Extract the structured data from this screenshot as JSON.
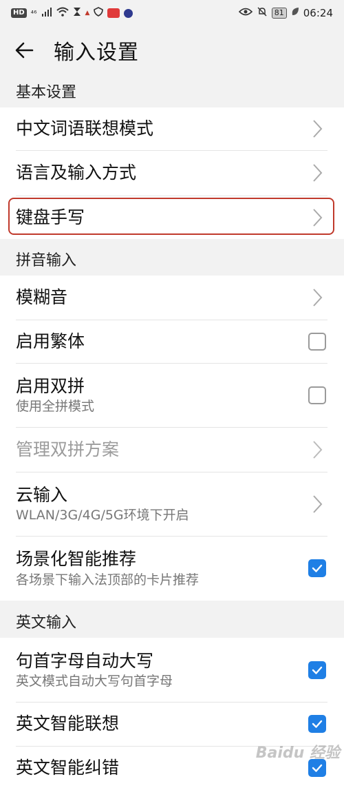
{
  "status_bar": {
    "left_badge": "HD",
    "network": "⁴⁶",
    "battery": "81",
    "time": "06:24"
  },
  "header": {
    "title": "输入设置",
    "back_icon": "back-arrow-icon"
  },
  "sections": {
    "basic": {
      "label": "基本设置",
      "rows": [
        {
          "title": "中文词语联想模式"
        },
        {
          "title": "语言及输入方式"
        },
        {
          "title": "键盘手写"
        }
      ]
    },
    "pinyin": {
      "label": "拼音输入",
      "rows": [
        {
          "title": "模糊音"
        },
        {
          "title": "启用繁体",
          "checked": false
        },
        {
          "title": "启用双拼",
          "subtitle": "使用全拼模式",
          "checked": false
        },
        {
          "title": "管理双拼方案",
          "disabled": true
        },
        {
          "title": "云输入",
          "subtitle": "WLAN/3G/4G/5G环境下开启"
        },
        {
          "title": "场景化智能推荐",
          "subtitle": "各场景下输入法顶部的卡片推荐",
          "checked": true
        }
      ]
    },
    "english": {
      "label": "英文输入",
      "rows": [
        {
          "title": "句首字母自动大写",
          "subtitle": "英文模式自动大写句首字母",
          "checked": true
        },
        {
          "title": "英文智能联想",
          "checked": true
        },
        {
          "title": "英文智能纠错",
          "checked": true
        }
      ]
    }
  },
  "watermark": "Baidu 经验",
  "colors": {
    "accent": "#1f7fe5",
    "highlight": "#c0392b",
    "background": "#f2f2f2"
  }
}
